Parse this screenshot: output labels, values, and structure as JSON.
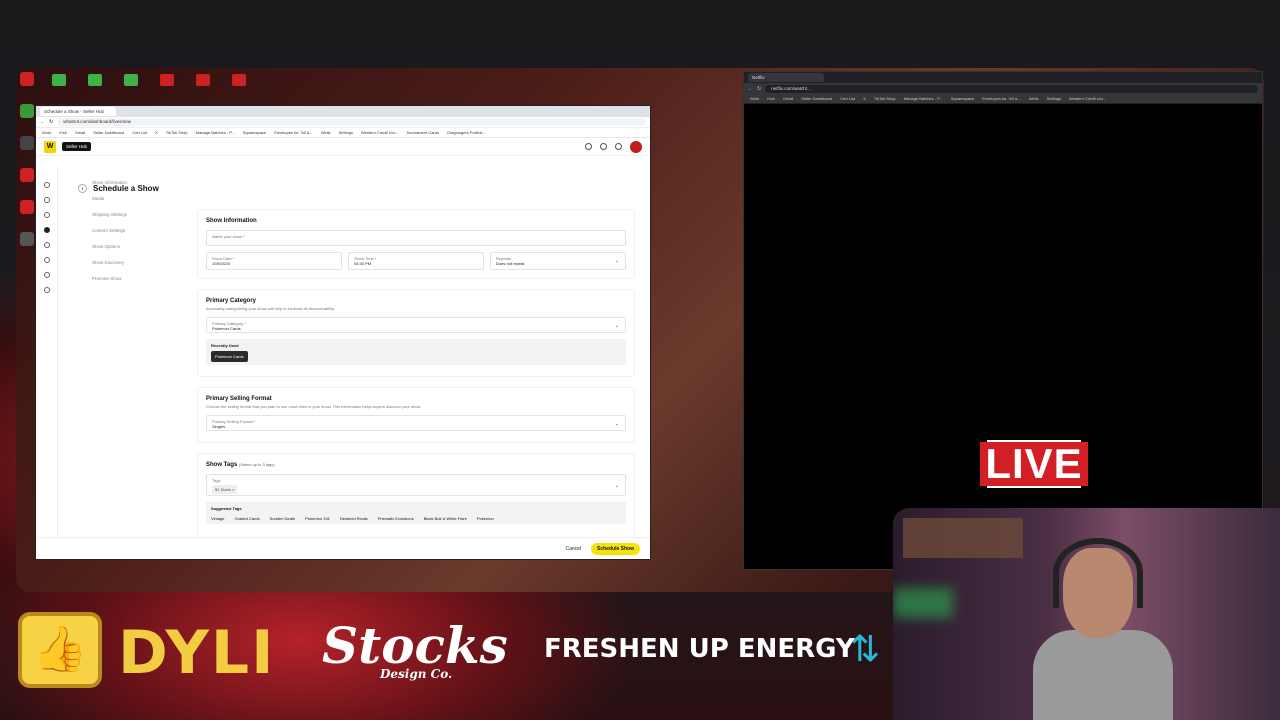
{
  "left_browser": {
    "tab_title": "Schedule a Show - Seller Hub",
    "url": "whatnot.com/dashboard/lives/new",
    "bookmarks": [
      "Work",
      "Kick",
      "Gmail",
      "Seller Dashboard",
      "Cert List",
      "X",
      "TikTok Shop",
      "Manage Batches - P...",
      "Squarespace",
      "Envelopes for \"All &...",
      "Wells",
      "Settings",
      "Western Credit Uni...",
      "Tournament Cards",
      "Outgoingers Portfoli..."
    ]
  },
  "app": {
    "hub_label": "Seller Hub",
    "page_title": "Schedule a Show",
    "steps": [
      "Show Information",
      "Media",
      "Shipping Settings",
      "Content Settings",
      "Show Options",
      "Show Discovery",
      "Promote Show"
    ]
  },
  "show_info": {
    "title": "Show Information",
    "name_placeholder": "Name your show *",
    "date_label": "Show Date *",
    "date_value": "10/5/2025",
    "time_label": "Show Time *",
    "time_value": "04:30 PM",
    "repeat_label": "Repeats",
    "repeat_value": "Does not repeat"
  },
  "primary_category": {
    "title": "Primary Category",
    "subtitle": "Accurately categorizing your show will help to increase its discoverability.",
    "field_label": "Primary Category *",
    "field_value": "Pokemon Cards",
    "recent_label": "Recently Used",
    "recent_chip": "Pokemon Cards"
  },
  "selling_format": {
    "title": "Primary Selling Format",
    "subtitle": "Choose the selling format that you plan to use most often in your show. This information helps buyers discover your show.",
    "field_label": "Primary Selling Format *",
    "field_value": "Singles"
  },
  "tags": {
    "title": "Show Tags",
    "title_note": "(Select up to 3 tags)",
    "field_label": "Tags",
    "selected": "$1 Starts",
    "suggested_label": "Suggested Tags",
    "suggested": [
      "Vintage",
      "Graded Cards",
      "Sudden Death",
      "Pokemon 151",
      "Destined Rivals",
      "Prismatic Evolutions",
      "Black Bolt & White Flare",
      "Pokemon"
    ]
  },
  "footer": {
    "cancel": "Cancel",
    "schedule": "Schedule Show"
  },
  "right_browser": {
    "tab_title": "Netflix",
    "url": "netflix.com/watch/...",
    "bookmarks": [
      "Work",
      "Kick",
      "Gmail",
      "Seller Dashboard",
      "Cert List",
      "X",
      "TikTok Shop",
      "Manage Batches - P...",
      "Squarespace",
      "Envelopes for \"All &...",
      "Wells",
      "Settings",
      "Western Credit Uni..."
    ]
  },
  "overlay": {
    "live": "LIVE",
    "sponsor1": "DYLI",
    "sponsor2": "Stocks",
    "sponsor2_sub": "Design Co.",
    "sponsor3": "FRESHEN UP ENERGY"
  },
  "colors": {
    "accent_yellow": "#f4e30a",
    "live_red": "#d21f26",
    "dyli_gold": "#f3cd41"
  }
}
